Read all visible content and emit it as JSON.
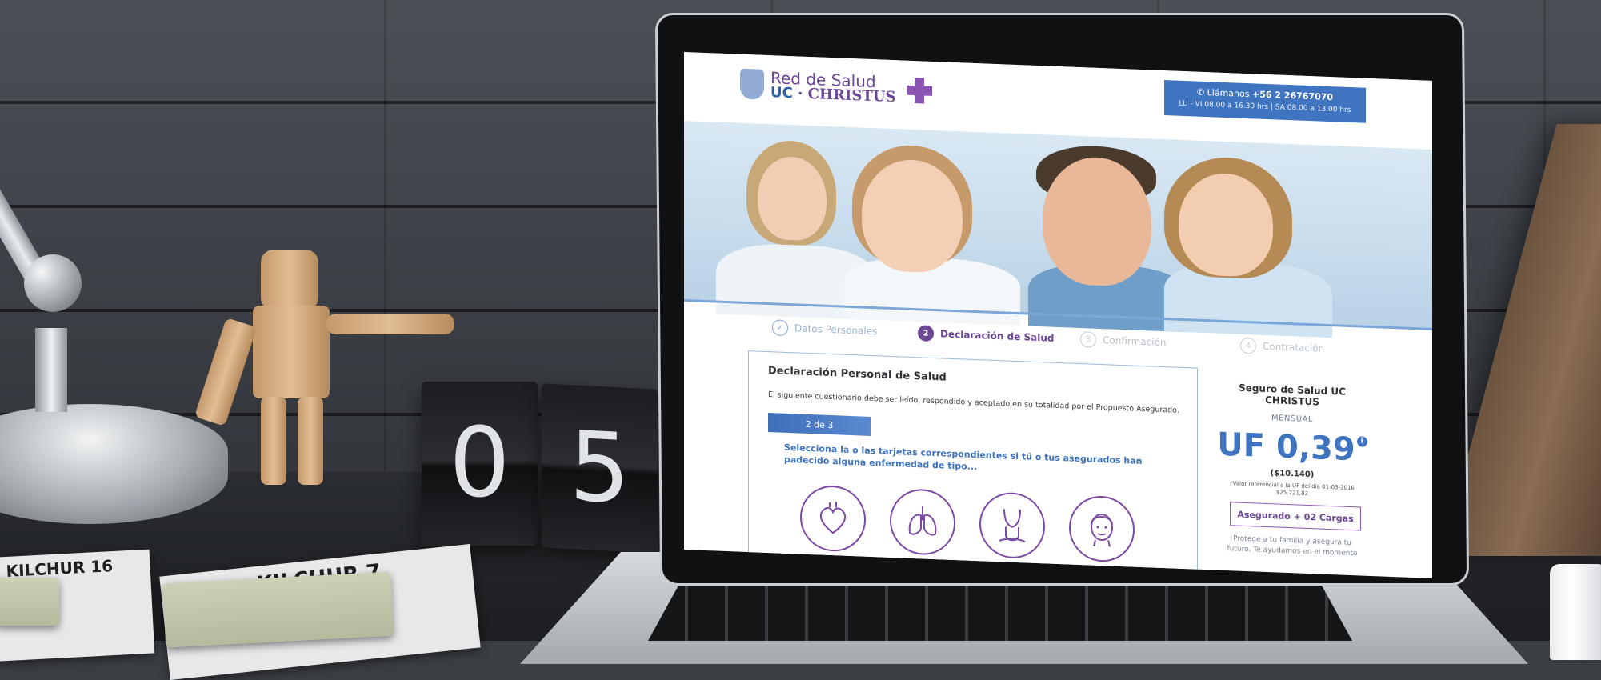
{
  "site": {
    "logo": {
      "line1": "Red de Salud",
      "line2_uc": "UC",
      "line2_sep": " · ",
      "line2_christus": "CHRISTUS"
    },
    "contact": {
      "label": "Llámanos",
      "phone": "+56 2 26767070",
      "hours": "LU - VI 08.00 a 16.30 hrs | SA 08.00 a 13.00 hrs"
    }
  },
  "steps": [
    {
      "number": "✓",
      "label": "Datos Personales",
      "state": "done"
    },
    {
      "number": "2",
      "label": "Declaración de Salud",
      "state": "active"
    },
    {
      "number": "3",
      "label": "Confirmación",
      "state": "inactive"
    },
    {
      "number": "4",
      "label": "Contratación",
      "state": "inactive"
    }
  ],
  "declaration": {
    "title": "Declaración Personal de Salud",
    "description": "El siguiente cuestionario debe ser leído, respondido y aceptado en su totalidad por el Propuesto Asegurado.",
    "progress_label": "2 de 3",
    "question": "Selecciona la o las tarjetas correspondientes si tú o tus asegurados han padecido alguna enfermedad de tipo...",
    "cards": [
      "heart-icon",
      "lungs-icon",
      "neck-icon",
      "face-icon"
    ]
  },
  "plan": {
    "title": "Seguro de Salud UC CHRISTUS",
    "period": "MENSUAL",
    "price": "UF 0,39",
    "price_clp": "($10.140)",
    "note_line1": "*Valor referencial a la UF del día 01-03-2016",
    "note_line2": "$25.721,82",
    "coverage_button": "Asegurado + 02 Cargas",
    "copy": "Protege a tu familia y asegura tu futuro. Te ayudamos en el momento"
  },
  "desk": {
    "clock_digits": [
      "0",
      "5"
    ],
    "magazine_title_1": "KILCHUR 16",
    "magazine_title_2": "KILCHUR 7"
  },
  "colors": {
    "brand_blue": "#3f74c1",
    "brand_purple": "#6d4796"
  }
}
